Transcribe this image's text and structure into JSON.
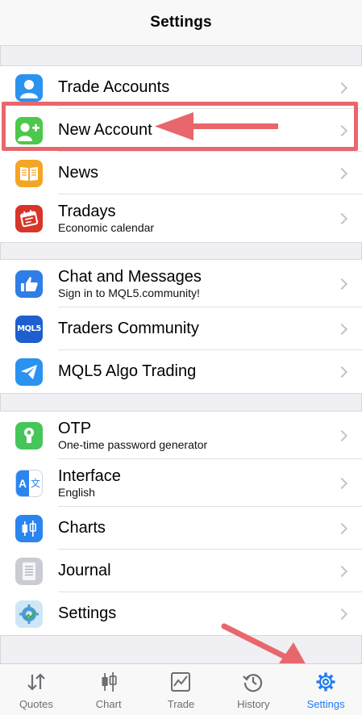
{
  "header": {
    "title": "Settings"
  },
  "groups": [
    {
      "items": [
        {
          "label": "Trade Accounts",
          "icon": "user-icon",
          "color": "#2a93ef"
        },
        {
          "label": "New Account",
          "icon": "add-user-icon",
          "color": "#4cc84a"
        },
        {
          "label": "News",
          "icon": "book-icon",
          "color": "#f5a524"
        },
        {
          "label": "Tradays",
          "sub": "Economic calendar",
          "icon": "calendar-icon",
          "color": "#d8352a"
        }
      ]
    },
    {
      "items": [
        {
          "label": "Chat and Messages",
          "sub": "Sign in to MQL5.community!",
          "icon": "thumbs-up-icon",
          "color": "#2e7ee6"
        },
        {
          "label": "Traders Community",
          "icon": "mql5-logo-icon",
          "color": "#1d5fcf",
          "logo_text": "MQL5"
        },
        {
          "label": "MQL5 Algo Trading",
          "icon": "send-icon",
          "color": "#2a93ef"
        }
      ]
    },
    {
      "items": [
        {
          "label": "OTP",
          "sub": "One-time password generator",
          "icon": "keyhole-icon",
          "color": "#45c65a"
        },
        {
          "label": "Interface",
          "sub": "English",
          "icon": "translate-icon",
          "color": "#2a85ee",
          "glyph_a": "A",
          "glyph_b": "文"
        },
        {
          "label": "Charts",
          "icon": "candlestick-icon",
          "color": "#2a85ee"
        },
        {
          "label": "Journal",
          "icon": "document-icon",
          "color": "#c9ccd3"
        },
        {
          "label": "Settings",
          "icon": "gear-app-icon",
          "color": "#cfe6f7"
        }
      ]
    }
  ],
  "tabs": [
    {
      "label": "Quotes",
      "icon": "quotes-icon"
    },
    {
      "label": "Chart",
      "icon": "chart-icon"
    },
    {
      "label": "Trade",
      "icon": "trade-icon"
    },
    {
      "label": "History",
      "icon": "history-icon"
    },
    {
      "label": "Settings",
      "icon": "gear-icon",
      "active": true
    }
  ],
  "colors": {
    "accent": "#1e7cf2",
    "annotation": "#e8676c"
  }
}
